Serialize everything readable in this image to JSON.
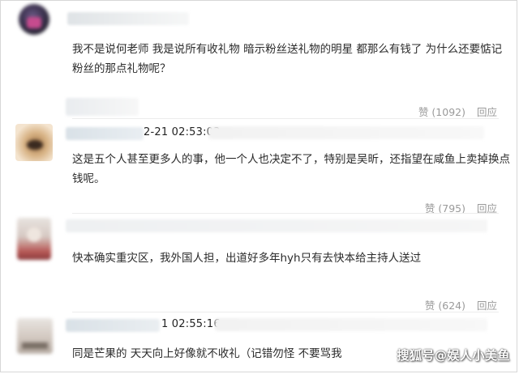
{
  "comments": [
    {
      "timestamp": "",
      "text": "我不是说何老师 我是说所有收礼物 暗示粉丝送礼物的明星 都那么有钱了 为什么还要惦记粉丝的那点礼物呢？",
      "like_label": "赞 (1092)",
      "reply_label": "回应"
    },
    {
      "timestamp": "2-21 02:53:03",
      "text": "这是五个人甚至更多人的事，他一个人也决定不了，特别是吴昕，还指望在咸鱼上卖掉换点钱呢。",
      "like_label": "赞 (795)",
      "reply_label": "回应"
    },
    {
      "timestamp": "",
      "text": "快本确实重灾区，我外国人担，出道好多年hyh只有去快本给主持人送过",
      "like_label": "赞 (624)",
      "reply_label": "回应"
    },
    {
      "timestamp": "1 02:55:16",
      "text": "同是芒果的 天天向上好像就不收礼（记错勿怪 不要骂我",
      "like_label": "",
      "reply_label": ""
    }
  ],
  "watermark": "搜狐号@娱人小美鱼",
  "colors": {
    "text": "#2b2b2b",
    "muted": "#9a9a9a",
    "divider": "#ececec"
  }
}
